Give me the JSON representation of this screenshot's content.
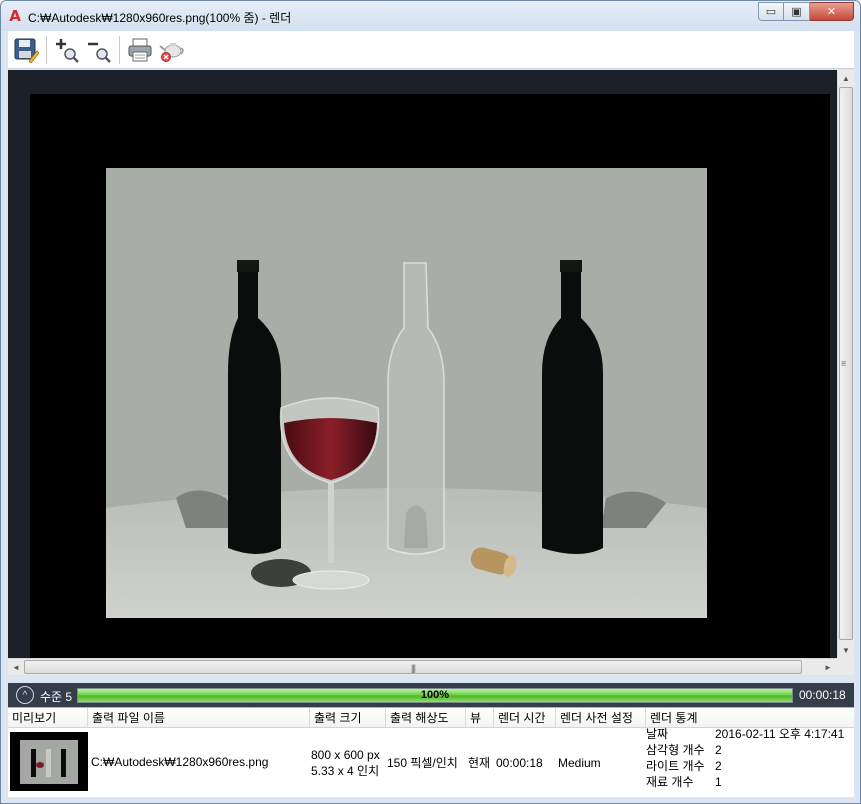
{
  "window": {
    "app_icon": "A",
    "title": "C:₩Autodesk₩1280x960res.png(100% 줌) - 렌더",
    "minimize": "▭",
    "restore": "▣",
    "close": "✕"
  },
  "toolbar": {
    "icons": [
      "save-icon",
      "zoom-in-icon",
      "zoom-out-icon",
      "print-icon",
      "cancel-render-icon"
    ]
  },
  "scroll": {
    "up": "▲",
    "down": "▼",
    "left": "◄",
    "right": "►",
    "grip": "|||"
  },
  "status": {
    "collapse": "^",
    "level": "수준 5",
    "progress_percent": 100,
    "progress_text": "100%",
    "elapsed": "00:00:18"
  },
  "history": {
    "columns": [
      "미리보기",
      "출력 파일 이름",
      "출력 크기",
      "출력 해상도",
      "뷰",
      "렌더 시간",
      "렌더 사전 설정",
      "렌더 통계"
    ],
    "row": {
      "file_name": "C:₩Autodesk₩1280x960res.png",
      "size_px": "800 x 600 px",
      "size_in": "5.33 x 4 인치",
      "resolution": "150 픽셀/인치",
      "view": "현재",
      "render_time": "00:00:18",
      "preset": "Medium",
      "stats": [
        {
          "key": "날짜",
          "value": "2016-02-11 오후 4:17:41"
        },
        {
          "key": "삼각형 개수",
          "value": "2"
        },
        {
          "key": "라이트 개수",
          "value": "2"
        },
        {
          "key": "재료 개수",
          "value": "1"
        }
      ]
    }
  },
  "colors": {
    "titlebar": "#d3e0ef",
    "viewport_bg": "#1b2129",
    "status_bg": "#343e4a",
    "progress_green": "#66cc3e",
    "close_red": "#c8473a"
  }
}
